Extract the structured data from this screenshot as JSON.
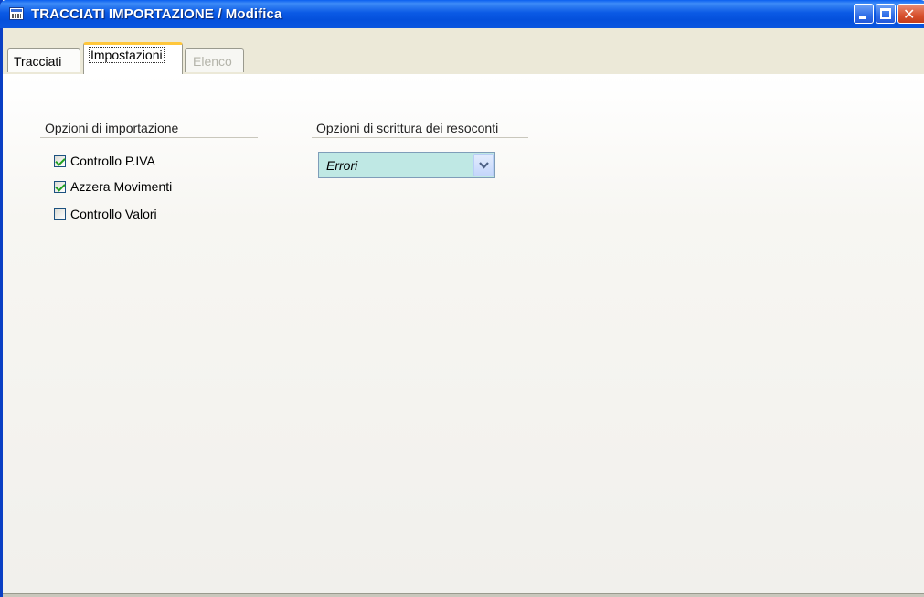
{
  "window": {
    "title": "TRACCIATI IMPORTAZIONE / Modifica",
    "icon": "app-window-icon",
    "controls": [
      "minimize-icon",
      "maximize-icon",
      "close-icon"
    ]
  },
  "tabs": [
    {
      "label": "Tracciati",
      "state": "normal"
    },
    {
      "label": "Impostazioni",
      "state": "selected"
    },
    {
      "label": "Elenco",
      "state": "disabled"
    }
  ],
  "import_options": {
    "title": "Opzioni di importazione",
    "items": [
      {
        "label": "Controllo P.IVA",
        "checked": true
      },
      {
        "label": "Azzera Movimenti",
        "checked": true
      },
      {
        "label": "Controllo Valori",
        "checked": false
      }
    ]
  },
  "report_options": {
    "title": "Opzioni di scrittura dei resoconti",
    "selected": "Errori"
  },
  "colors": {
    "titlebar": "#0450dc",
    "combo_background": "#bfe8e4",
    "selected_tab_accent": "#ffc73c",
    "check_mark": "#21a121"
  }
}
